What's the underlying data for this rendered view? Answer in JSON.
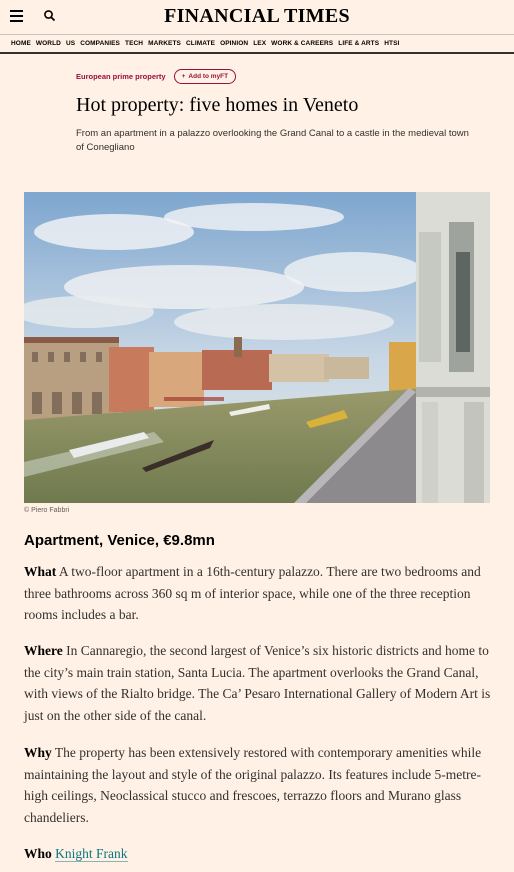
{
  "header": {
    "brand": "FINANCIAL TIMES",
    "menu_icon": "hamburger-menu-icon",
    "search_icon": "search-icon"
  },
  "nav": [
    "HOME",
    "WORLD",
    "US",
    "COMPANIES",
    "TECH",
    "MARKETS",
    "CLIMATE",
    "OPINION",
    "LEX",
    "WORK & CAREERS",
    "LIFE & ARTS",
    "HTSI"
  ],
  "article": {
    "topic": "European prime property",
    "myft_label": "Add to myFT",
    "headline": "Hot property: five homes in Veneto",
    "standfirst": "From an apartment in a palazzo overlooking the Grand Canal to a castle in the medieval town of Conegliano",
    "photo_caption": "© Piero Fabbri",
    "subhead": "Apartment, Venice, €9.8mn",
    "what_label": "What",
    "what_text": "A two-floor apartment in a 16th-century palazzo. There are two bedrooms and three bathrooms across 360 sq m of interior space, while one of the three reception rooms includes a bar.",
    "where_label": "Where",
    "where_text": "In Cannaregio, the second largest of Venice’s six historic districts and home to the city’s main train station, Santa Lucia. The apartment overlooks the Grand Canal, with views of the Rialto bridge. The Ca’ Pesaro International Gallery of Modern Art is just on the other side of the canal.",
    "why_label": "Why",
    "why_text": "The property has been extensively restored with contemporary amenities while maintaining the layout and style of the original palazzo. Its features include 5-metre-high ceilings, Neoclassical stucco and frescoes, terrazzo floors and Murano glass chandeliers.",
    "who_label": "Who",
    "who_link": "Knight Frank"
  },
  "colors": {
    "background": "#fff1e5",
    "claret": "#990f3d",
    "link": "#0d7680"
  }
}
